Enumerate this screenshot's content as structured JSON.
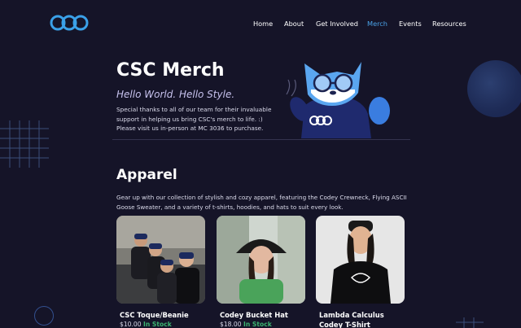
{
  "header": {
    "logo_icon": "csc-logo-icon",
    "nav": [
      {
        "label": "Home",
        "active": false
      },
      {
        "label": "About",
        "active": false
      },
      {
        "label": "Get Involved",
        "active": false
      },
      {
        "label": "Merch",
        "active": true
      },
      {
        "label": "Events",
        "active": false
      },
      {
        "label": "Resources",
        "active": false
      }
    ],
    "active_color": "#4aa3e8"
  },
  "hero": {
    "title": "CSC Merch",
    "subtitle": "Hello World. Hello Style.",
    "description_line1": "Special thanks to all of our team for their invaluable",
    "description_line2": "support in helping us bring CSC's merch to life. :)",
    "description_line3": "Please visit us in-person at MC 3036 to purchase.",
    "mascot_icon": "codey-mascot-icon"
  },
  "apparel": {
    "title": "Apparel",
    "description": "Gear up with our collection of stylish and cozy apparel, featuring the Codey Crewneck, Flying ASCII Goose Sweater, and a variety of t-shirts, hoodies, and hats to suit every look.",
    "items": [
      {
        "name": "CSC Toque/Beanie",
        "price": "$10.00",
        "stock": "In Stock"
      },
      {
        "name": "Codey Bucket Hat",
        "price": "$18.00",
        "stock": "In Stock"
      },
      {
        "name": "Lambda Calculus Codey T-Shirt",
        "price": "",
        "stock": ""
      }
    ]
  },
  "colors": {
    "background": "#151428",
    "accent": "#4aa3e8",
    "in_stock": "#3cb371"
  }
}
